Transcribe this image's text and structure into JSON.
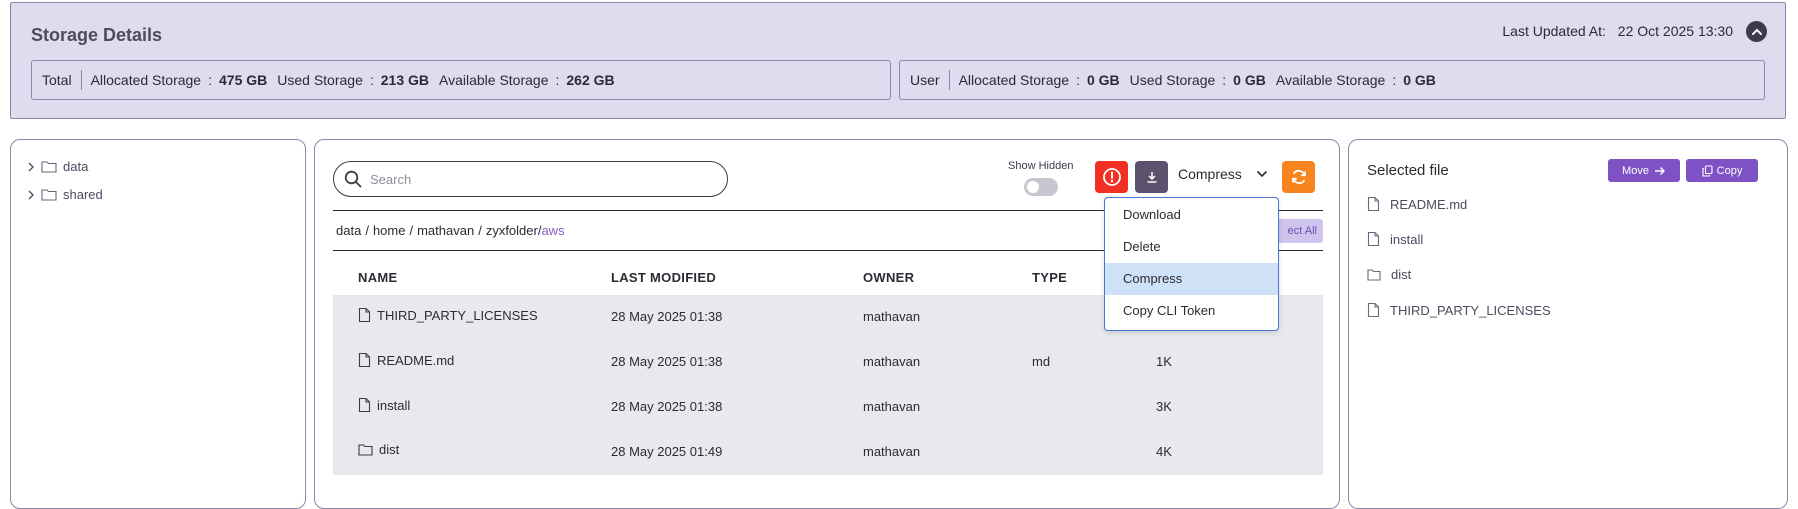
{
  "storage": {
    "title": "Storage Details",
    "last_updated_label": "Last Updated At:",
    "last_updated_value": "22 Oct 2025 13:30",
    "total": {
      "label": "Total",
      "allocated_label": "Allocated Storage",
      "allocated_value": "475 GB",
      "used_label": "Used Storage",
      "used_value": "213 GB",
      "available_label": "Available Storage",
      "available_value": "262 GB"
    },
    "user": {
      "label": "User",
      "allocated_label": "Allocated Storage",
      "allocated_value": "0 GB",
      "used_label": "Used Storage",
      "used_value": "0 GB",
      "available_label": "Available Storage",
      "available_value": "0 GB"
    },
    "separator": ":"
  },
  "tree": {
    "items": [
      {
        "label": "data"
      },
      {
        "label": "shared"
      }
    ]
  },
  "toolbar": {
    "search_placeholder": "Search",
    "show_hidden_label": "Show Hidden",
    "compress_label": "Compress"
  },
  "breadcrumb": {
    "parts": [
      "data",
      "home",
      "mathavan",
      "zyxfolder/"
    ],
    "active": "aws",
    "select_all_label": "ect All"
  },
  "table": {
    "headers": [
      "NAME",
      "LAST MODIFIED",
      "OWNER",
      "TYPE"
    ],
    "rows": [
      {
        "name": "THIRD_PARTY_LICENSES",
        "modified": "28 May 2025 01:38",
        "owner": "mathavan",
        "type": "",
        "size": "",
        "icon": "file-icon"
      },
      {
        "name": "README.md",
        "modified": "28 May 2025 01:38",
        "owner": "mathavan",
        "type": "md",
        "size": "1K",
        "icon": "file-icon"
      },
      {
        "name": "install",
        "modified": "28 May 2025 01:38",
        "owner": "mathavan",
        "type": "",
        "size": "3K",
        "icon": "file-icon"
      },
      {
        "name": "dist",
        "modified": "28 May 2025 01:49",
        "owner": "mathavan",
        "type": "",
        "size": "4K",
        "icon": "folder-icon"
      }
    ]
  },
  "dropdown": {
    "items": [
      "Download",
      "Delete",
      "Compress",
      "Copy CLI Token"
    ],
    "selected": "Compress"
  },
  "selected_panel": {
    "title": "Selected file",
    "move_label": "Move",
    "copy_label": "Copy",
    "items": [
      {
        "label": "README.md",
        "icon": "file-icon"
      },
      {
        "label": "install",
        "icon": "file-icon"
      },
      {
        "label": "dist",
        "icon": "folder-icon"
      },
      {
        "label": "THIRD_PARTY_LICENSES",
        "icon": "file-icon"
      }
    ]
  },
  "colors": {
    "header_bg": "#e1dbf0",
    "accent_purple": "#7e52c4",
    "alert_red": "#f12f22",
    "refresh_orange": "#f7841f",
    "dropdown_selected": "#cfe1f7"
  }
}
